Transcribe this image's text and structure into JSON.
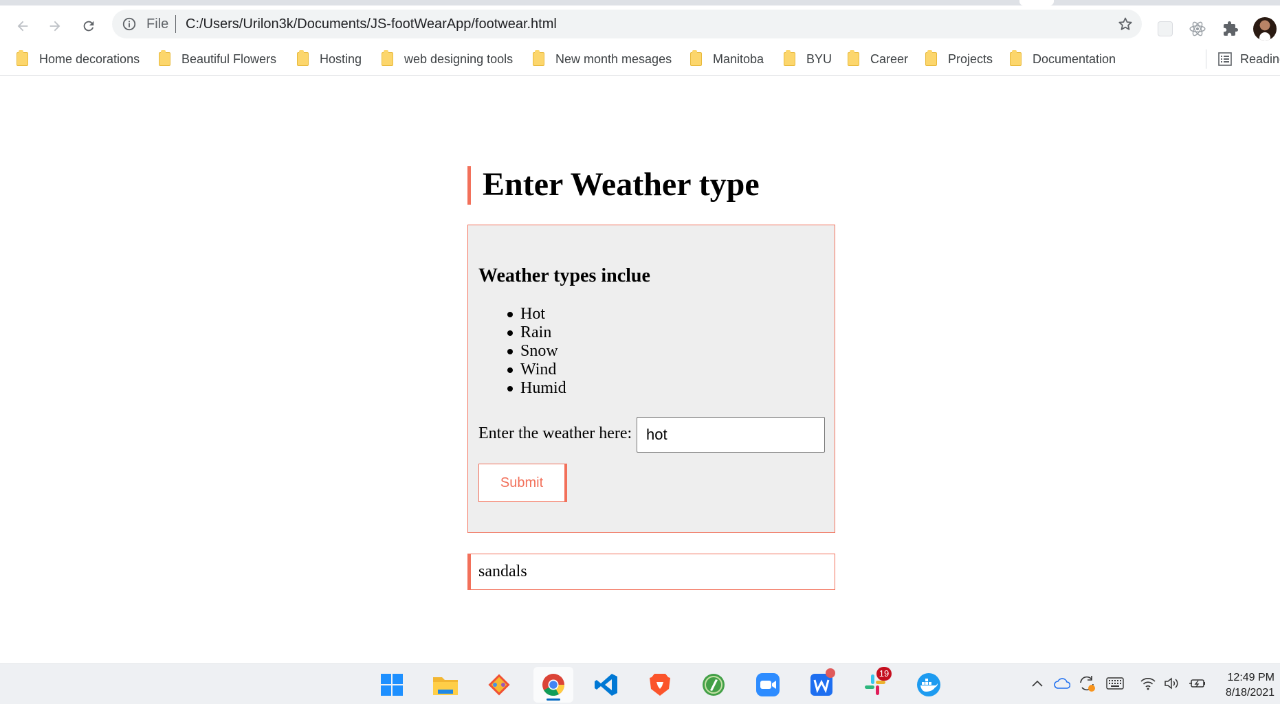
{
  "browser": {
    "url_scheme": "File",
    "url": "C:/Users/Urilon3k/Documents/JS-footWearApp/footwear.html",
    "bookmarks": [
      {
        "label": "Home decorations"
      },
      {
        "label": "Beautiful Flowers"
      },
      {
        "label": "Hosting"
      },
      {
        "label": "web designing tools"
      },
      {
        "label": "New month mesages"
      },
      {
        "label": "Manitoba"
      },
      {
        "label": "BYU"
      },
      {
        "label": "Career"
      },
      {
        "label": "Projects"
      },
      {
        "label": "Documentation"
      }
    ],
    "reading_list_label": "Reading list"
  },
  "page": {
    "title": "Enter Weather type",
    "panel_heading": "Weather types inclue",
    "weather_types": [
      "Hot",
      "Rain",
      "Snow",
      "Wind",
      "Humid"
    ],
    "input_label": "Enter the weather here:",
    "input_value": "hot",
    "submit_label": "Submit",
    "result": "sandals",
    "accent_color": "#f2705a"
  },
  "taskbar": {
    "apps": [
      {
        "name": "windows-start-icon"
      },
      {
        "name": "file-explorer-icon"
      },
      {
        "name": "git-icon"
      },
      {
        "name": "chrome-icon",
        "active": true
      },
      {
        "name": "vscode-icon"
      },
      {
        "name": "brave-icon"
      },
      {
        "name": "green-app-icon"
      },
      {
        "name": "zoom-icon"
      },
      {
        "name": "wps-office-icon"
      },
      {
        "name": "slack-icon",
        "badge": "19"
      },
      {
        "name": "docker-icon"
      }
    ],
    "clock": {
      "time": "12:49 PM",
      "date": "8/18/2021"
    }
  }
}
